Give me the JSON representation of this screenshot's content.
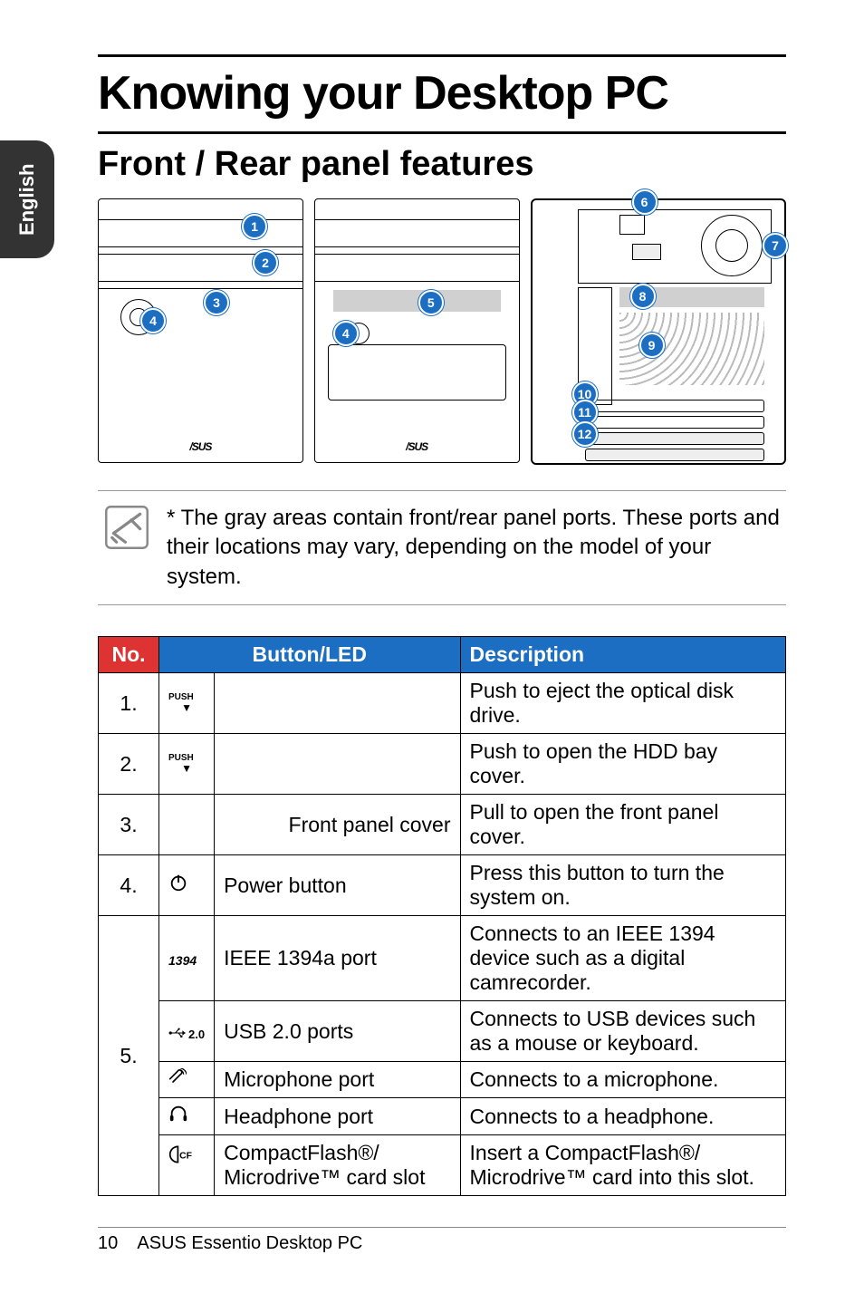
{
  "sideTab": "English",
  "mainTitle": "Knowing your Desktop PC",
  "sectionTitle": "Front / Rear panel features",
  "note": "* The gray areas contain front/rear panel ports. These ports and their locations may vary, depending on the model of your system.",
  "callouts": {
    "c1": "1",
    "c2": "2",
    "c3": "3",
    "c4": "4",
    "c5": "5",
    "c6": "6",
    "c7": "7",
    "c8": "8",
    "c9": "9",
    "c10": "10",
    "c11": "11",
    "c12": "12"
  },
  "tableHead": {
    "no": "No.",
    "btn": "Button/LED",
    "desc": "Description"
  },
  "rows": {
    "r1": {
      "no": "1.",
      "label": "",
      "desc": "Push to eject the optical disk drive."
    },
    "r2": {
      "no": "2.",
      "label": "",
      "desc": "Push to open the HDD bay cover."
    },
    "r3": {
      "no": "3.",
      "label": "Front panel cover",
      "desc": "Pull to open the front panel cover."
    },
    "r4": {
      "no": "4.",
      "label": "Power button",
      "desc": "Press this button to turn the system on."
    },
    "r5": {
      "no": "5."
    },
    "r5a": {
      "label": "IEEE 1394a port",
      "desc": "Connects to an IEEE 1394 device such as a digital camrecorder."
    },
    "r5b": {
      "label": "USB 2.0 ports",
      "desc": "Connects to USB devices such as a mouse or keyboard."
    },
    "r5c": {
      "label": "Microphone port",
      "desc": "Connects to a microphone."
    },
    "r5d": {
      "label": "Headphone port",
      "desc": "Connects to a headphone."
    },
    "r5e": {
      "label": "CompactFlash®/ Microdrive™ card slot",
      "desc": "Insert a CompactFlash®/ Microdrive™ card into this slot."
    }
  },
  "iconLabels": {
    "push": "PUSH",
    "ieee": "1394",
    "usb": "2.0"
  },
  "footer": {
    "page": "10",
    "product": "ASUS Essentio Desktop PC"
  },
  "asusLogo": "/SUS"
}
